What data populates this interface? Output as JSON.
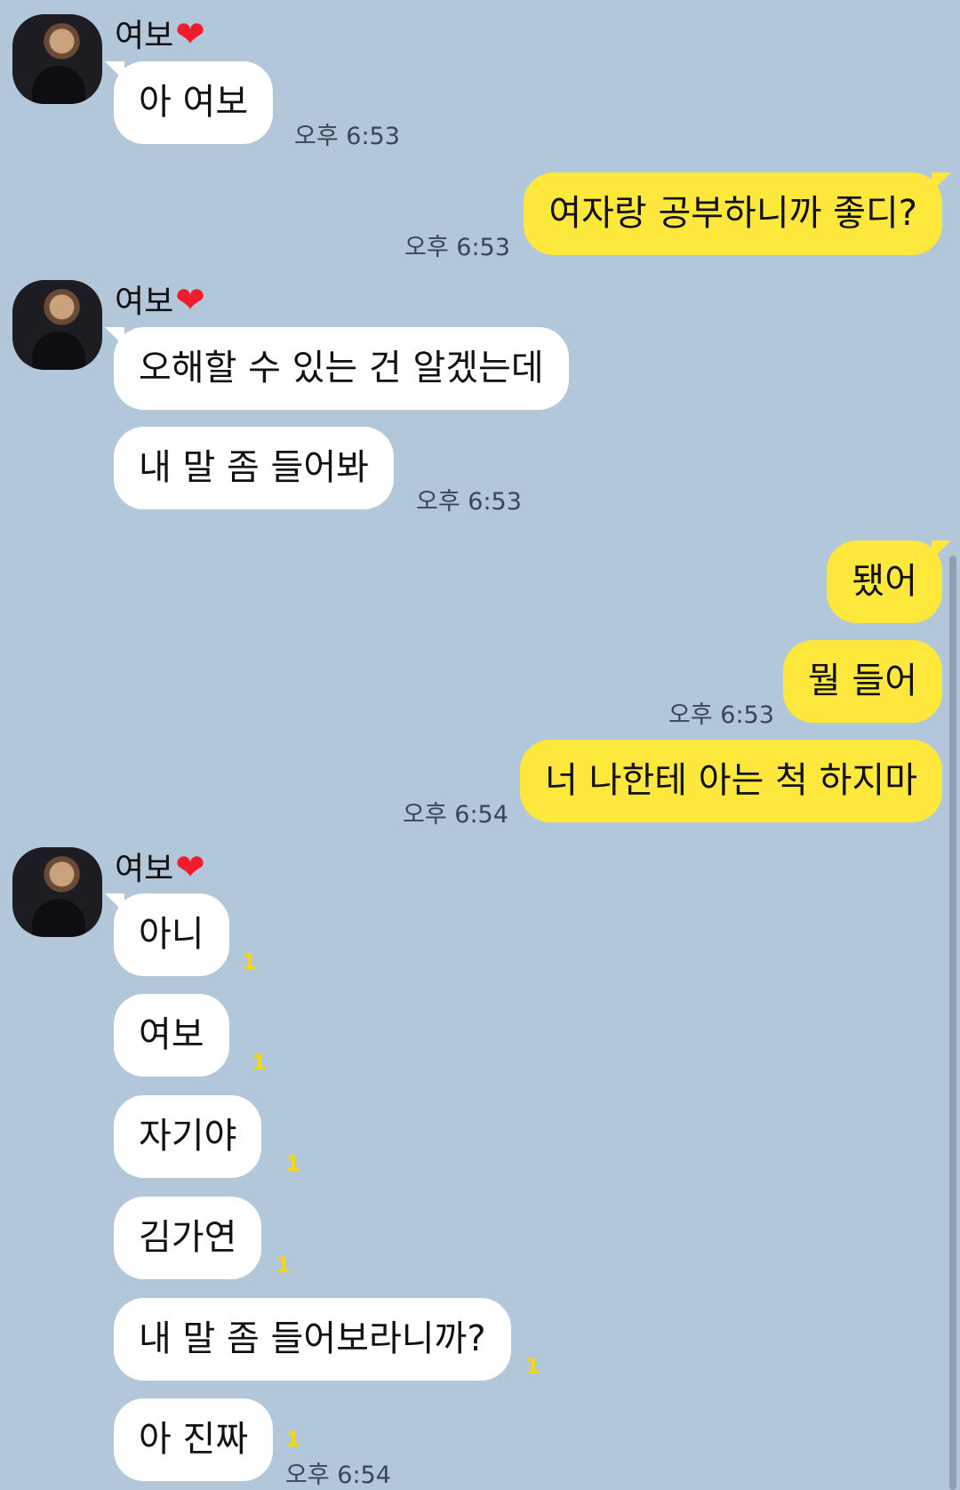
{
  "contact": {
    "name": "여보",
    "heart": "❤"
  },
  "messages": [
    {
      "side": "left",
      "text": "아 여보",
      "time": "오후 6:53"
    },
    {
      "side": "right",
      "text": "여자랑 공부하니까 좋디?",
      "time": "오후 6:53"
    },
    {
      "side": "left",
      "text": "오해할 수 있는 건 알겠는데"
    },
    {
      "side": "left",
      "text": "내 말 좀 들어봐",
      "time": "오후 6:53"
    },
    {
      "side": "right",
      "text": "됐어"
    },
    {
      "side": "right",
      "text": "뭘 들어",
      "time": "오후 6:53"
    },
    {
      "side": "right",
      "text": "너 나한테 아는 척 하지마",
      "time": "오후 6:54"
    },
    {
      "side": "left",
      "text": "아니",
      "unread": "1"
    },
    {
      "side": "left",
      "text": "여보",
      "unread": "1"
    },
    {
      "side": "left",
      "text": "자기야",
      "unread": "1"
    },
    {
      "side": "left",
      "text": "김가연",
      "unread": "1"
    },
    {
      "side": "left",
      "text": "내 말 좀 들어보라니까?",
      "unread": "1"
    },
    {
      "side": "left",
      "text": "아 진짜",
      "unread": "1",
      "time": "오후 6:54"
    }
  ],
  "colors": {
    "background": "#b2c7da",
    "my_bubble": "#fee83c",
    "their_bubble": "#ffffff",
    "unread": "#f5d612",
    "heart": "#ee1c2c"
  }
}
